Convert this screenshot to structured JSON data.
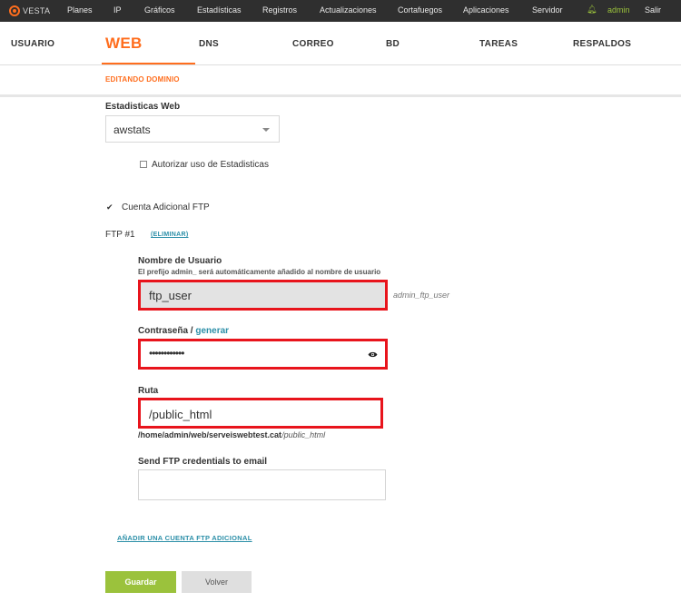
{
  "topbar": {
    "logo": "VESTA",
    "menu": [
      "Planes",
      "IP",
      "Gráficos",
      "Estadísticas",
      "Registros",
      "Actualizaciones",
      "Cortafuegos",
      "Aplicaciones",
      "Servidor"
    ],
    "user": "admin",
    "logout": "Salir"
  },
  "mainnav": {
    "tabs": [
      "USUARIO",
      "WEB",
      "DNS",
      "CORREO",
      "BD",
      "TAREAS",
      "RESPALDOS"
    ],
    "active": "WEB"
  },
  "breadcrumb": "EDITANDO DOMINIO",
  "form": {
    "stats_label": "Estadisticas Web",
    "stats_value": "awstats",
    "stats_auth_label": "Autorizar uso de Estadisticas",
    "ftp_account_label": "Cuenta Adicional FTP",
    "ftp_account_checked": true,
    "ftp_title": "FTP #1",
    "ftp_remove": "(ELIMINAR)",
    "username_label": "Nombre de Usuario",
    "username_hint": "El prefijo admin_ será automáticamente añadido al nombre de usuario",
    "username_value": "ftp_user",
    "username_full": "admin_ftp_user",
    "password_label": "Contraseña /",
    "password_generate": "generar",
    "password_value": "••••••••••••",
    "path_label": "Ruta",
    "path_value": "/public_html",
    "path_full_base": "/home/admin/web/serveiswebtest.cat",
    "path_full_suffix": "/public_html",
    "email_label": "Send FTP credentials to email",
    "email_value": "",
    "add_ftp": "AÑADIR UNA CUENTA FTP ADICIONAL"
  },
  "buttons": {
    "save": "Guardar",
    "back": "Volver"
  },
  "colors": {
    "accent": "#ff6e1e",
    "green": "#9bc23c",
    "link": "#2c8fa8",
    "highlight": "#e8141c",
    "topbar": "#2f2f2f"
  }
}
